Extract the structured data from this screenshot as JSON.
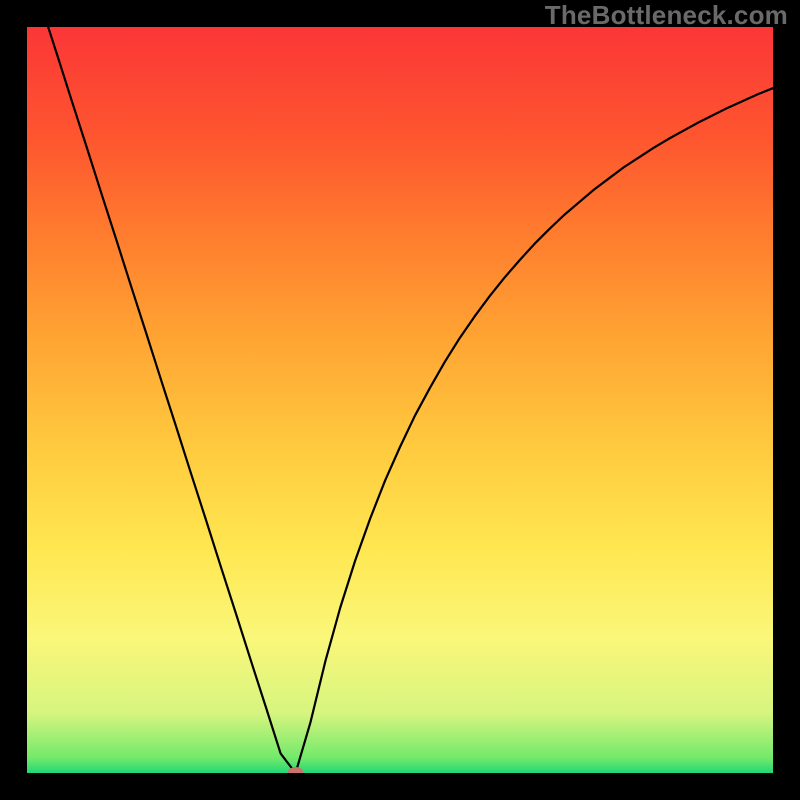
{
  "watermark": "TheBottleneck.com",
  "colors": {
    "frame_background": "#000000",
    "curve_stroke": "#000000",
    "marker_fill": "#c9736a",
    "watermark_text": "#6a6a6a",
    "gradient_stops": [
      "#22d776",
      "#72e96b",
      "#d6f57f",
      "#faf77a",
      "#ffe751",
      "#ffc93e",
      "#ffa533",
      "#ff7d2e",
      "#fe562f",
      "#fb3637"
    ]
  },
  "chart_data": {
    "type": "line",
    "title": "",
    "xlabel": "",
    "ylabel": "",
    "xlim": [
      0,
      1
    ],
    "ylim": [
      0,
      100
    ],
    "x": [
      0.0,
      0.02,
      0.04,
      0.06,
      0.08,
      0.1,
      0.12,
      0.14,
      0.16,
      0.18,
      0.2,
      0.22,
      0.24,
      0.26,
      0.28,
      0.3,
      0.32,
      0.34,
      0.36,
      0.38,
      0.4,
      0.42,
      0.44,
      0.46,
      0.48,
      0.5,
      0.52,
      0.54,
      0.56,
      0.58,
      0.6,
      0.62,
      0.64,
      0.66,
      0.68,
      0.7,
      0.72,
      0.74,
      0.76,
      0.78,
      0.8,
      0.82,
      0.84,
      0.86,
      0.88,
      0.9,
      0.92,
      0.94,
      0.96,
      0.98,
      1.0
    ],
    "values": [
      108.9,
      102.6,
      96.4,
      90.1,
      83.9,
      77.6,
      71.4,
      65.1,
      58.9,
      52.6,
      46.4,
      40.1,
      33.9,
      27.6,
      21.4,
      15.1,
      8.9,
      2.6,
      0.0,
      6.8,
      15.0,
      22.2,
      28.5,
      34.1,
      39.2,
      43.7,
      47.9,
      51.6,
      55.1,
      58.3,
      61.2,
      63.9,
      66.4,
      68.7,
      70.9,
      72.9,
      74.8,
      76.5,
      78.2,
      79.7,
      81.2,
      82.5,
      83.8,
      85.0,
      86.1,
      87.2,
      88.2,
      89.2,
      90.1,
      91.0,
      91.8
    ],
    "marker": {
      "x": 0.36,
      "y": 0.0
    },
    "notes": "x is normalized horizontal position across the plot (0=left, 1=right); y is percentage bottleneck (0 at bottom, 100+ off-top). Curve minimum at x≈0.36."
  }
}
